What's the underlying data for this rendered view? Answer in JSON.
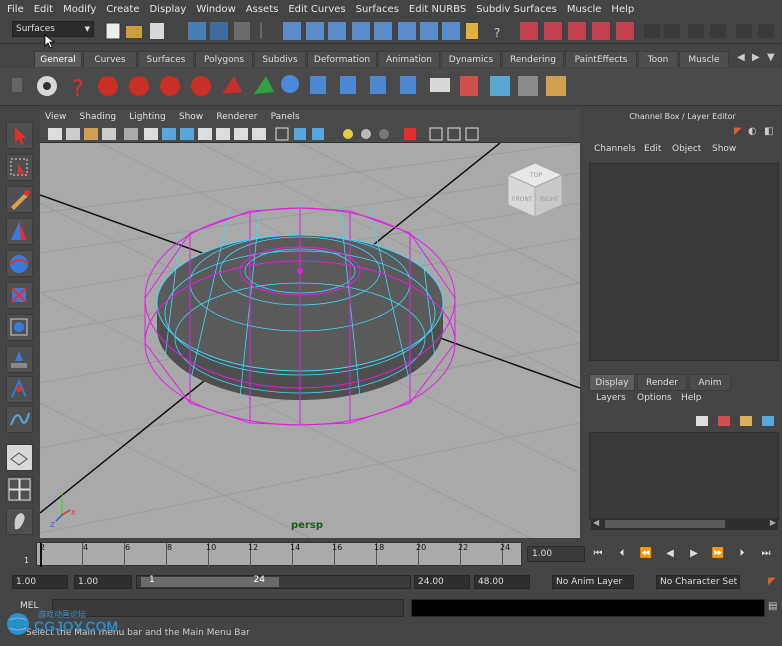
{
  "menubar": {
    "items": [
      "File",
      "Edit",
      "Modify",
      "Create",
      "Display",
      "Window",
      "Assets",
      "Edit Curves",
      "Surfaces",
      "Edit NURBS",
      "Subdiv Surfaces",
      "Muscle",
      "Help"
    ]
  },
  "statusline": {
    "mode": "Surfaces"
  },
  "shelf": {
    "tabs": [
      "General",
      "Curves",
      "Surfaces",
      "Polygons",
      "Subdivs",
      "Deformation",
      "Animation",
      "Dynamics",
      "Rendering",
      "PaintEffects",
      "Toon",
      "Muscle"
    ],
    "active": "General"
  },
  "viewport": {
    "menu": [
      "View",
      "Shading",
      "Lighting",
      "Show",
      "Renderer",
      "Panels"
    ],
    "camera": "persp",
    "cube": {
      "top": "TOP",
      "front": "FRONT",
      "right": "RIGHT"
    },
    "axes": {
      "y": "Y",
      "x": "X",
      "z": "Z"
    }
  },
  "channelbox": {
    "title": "Channel Box / Layer Editor",
    "menu": [
      "Channels",
      "Edit",
      "Object",
      "Show"
    ]
  },
  "layers": {
    "tabs": [
      "Display",
      "Render",
      "Anim"
    ],
    "menu": [
      "Layers",
      "Options",
      "Help"
    ]
  },
  "timeslider": {
    "ticks": [
      "1",
      "2",
      "4",
      "6",
      "8",
      "10",
      "12",
      "14",
      "16",
      "18",
      "20",
      "22",
      "24"
    ],
    "current": "1.00"
  },
  "range": {
    "start": "1.00",
    "start2": "1.00",
    "inner_start": "1",
    "inner_end": "24",
    "end": "24.00",
    "end2": "48.00",
    "anim_layer": "No Anim Layer",
    "char_set": "No Character Set"
  },
  "cmd": {
    "label": "MEL"
  },
  "help": {
    "text": "Select the Main menu bar and the Main Menu Bar"
  },
  "watermark": {
    "brand": "CGJOY.COM",
    "sub": "游戏动画论坛"
  },
  "colors": {
    "bg": "#444444",
    "viewport": "#a9a9a9",
    "wire_magenta": "#e020e0",
    "wire_cyan": "#40d8ff",
    "torus": "#4a4a4a"
  }
}
